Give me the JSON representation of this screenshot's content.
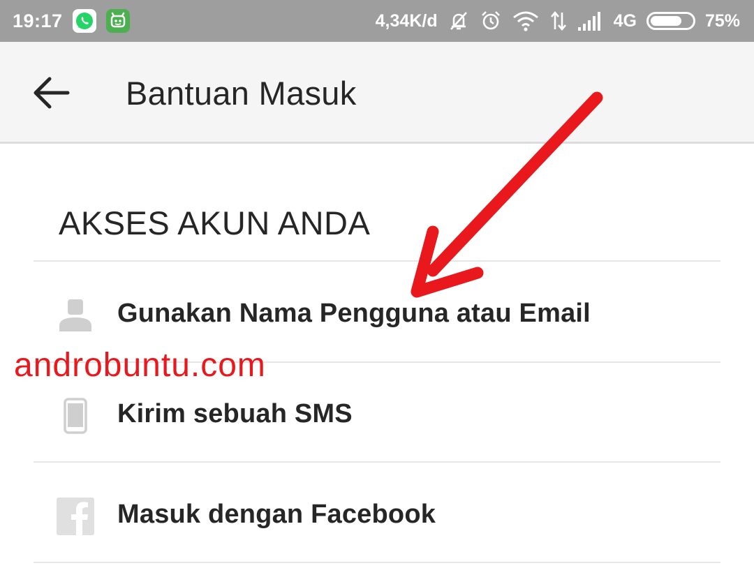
{
  "status_bar": {
    "time": "19:17",
    "net_speed": "4,34K/d",
    "network_type": "4G",
    "battery_percent": "75%",
    "battery_level": 0.75,
    "icons": [
      "whatsapp-icon",
      "game-app-icon",
      "mute-bell-icon",
      "alarm-icon",
      "wifi-icon",
      "data-transfer-icon",
      "signal-icon",
      "battery-icon"
    ]
  },
  "toolbar": {
    "title": "Bantuan Masuk",
    "back_icon": "arrow-left-icon"
  },
  "section": {
    "heading": "AKSES AKUN ANDA",
    "options": [
      {
        "label": "Gunakan Nama Pengguna atau Email",
        "icon": "person-icon"
      },
      {
        "label": "Kirim sebuah SMS",
        "icon": "phone-icon"
      },
      {
        "label": "Masuk dengan Facebook",
        "icon": "facebook-icon"
      }
    ]
  },
  "watermark": "androbuntu.com",
  "colors": {
    "status_bar": "#9e9e9e",
    "toolbar_bg": "#f5f5f5",
    "text": "#262626",
    "icon_gray": "#cfcfcf",
    "annotation_red": "#e8181c",
    "whatsapp_green": "#25d366"
  }
}
